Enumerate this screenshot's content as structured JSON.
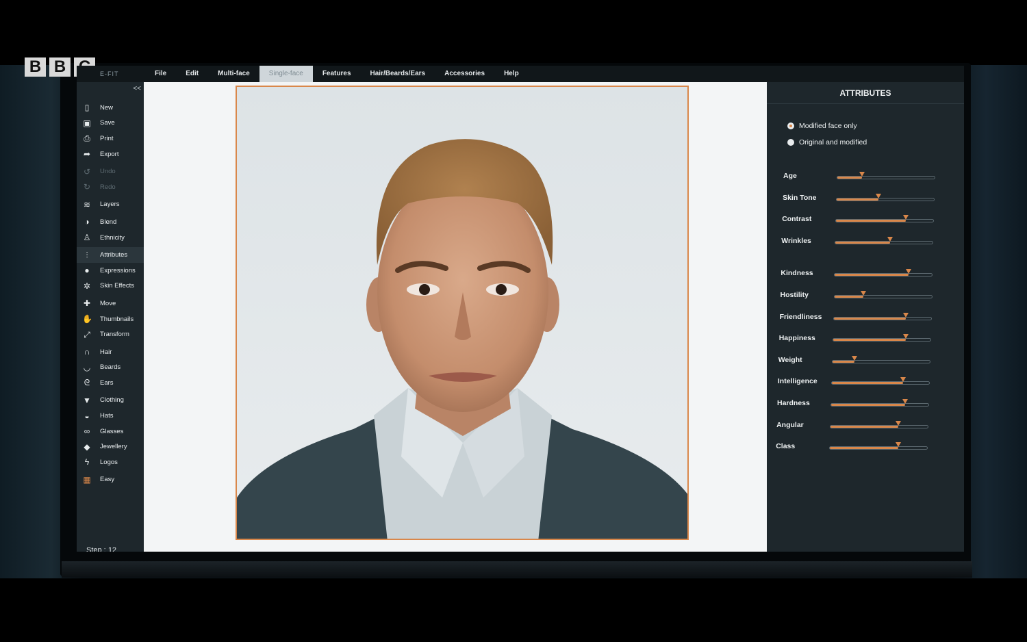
{
  "broadcaster": {
    "letters": [
      "B",
      "B",
      "C"
    ]
  },
  "app": {
    "logo": "E-FIT"
  },
  "menu": [
    {
      "label": "File",
      "active": false
    },
    {
      "label": "Edit",
      "active": false
    },
    {
      "label": "Multi-face",
      "active": false
    },
    {
      "label": "Single-face",
      "active": true
    },
    {
      "label": "Features",
      "active": false
    },
    {
      "label": "Hair/Beards/Ears",
      "active": false
    },
    {
      "label": "Accessories",
      "active": false
    },
    {
      "label": "Help",
      "active": false
    }
  ],
  "toolbar": {
    "collapse": "<<",
    "tools": [
      {
        "label": "New",
        "icon": "file-icon",
        "glyph": "▯",
        "disabled": false
      },
      {
        "label": "Save",
        "icon": "save-icon",
        "glyph": "▣",
        "disabled": false
      },
      {
        "label": "Print",
        "icon": "printer-icon",
        "glyph": "⎙",
        "disabled": false
      },
      {
        "label": "Export",
        "icon": "export-icon",
        "glyph": "➦",
        "disabled": false
      },
      {
        "label": "Undo",
        "icon": "undo-icon",
        "glyph": "↺",
        "disabled": true
      },
      {
        "label": "Redo",
        "icon": "redo-icon",
        "glyph": "↻",
        "disabled": true
      },
      {
        "label": "Layers",
        "icon": "layers-icon",
        "glyph": "≋",
        "disabled": false
      },
      {
        "label": "Blend",
        "icon": "blend-icon",
        "glyph": "◑",
        "disabled": false
      },
      {
        "label": "Ethnicity",
        "icon": "person-icon",
        "glyph": "♙",
        "disabled": false
      },
      {
        "label": "Attributes",
        "icon": "sliders-icon",
        "glyph": "⫶",
        "disabled": false,
        "active": true
      },
      {
        "label": "Expressions",
        "icon": "face-icon",
        "glyph": "●",
        "disabled": false
      },
      {
        "label": "Skin Effects",
        "icon": "sparkle-icon",
        "glyph": "✲",
        "disabled": false
      },
      {
        "label": "Move",
        "icon": "move-icon",
        "glyph": "✚",
        "disabled": false
      },
      {
        "label": "Thumbnails",
        "icon": "hand-icon",
        "glyph": "✋",
        "disabled": false
      },
      {
        "label": "Transform",
        "icon": "transform-icon",
        "glyph": "⤢",
        "disabled": false
      },
      {
        "label": "Hair",
        "icon": "hair-icon",
        "glyph": "∩",
        "disabled": false
      },
      {
        "label": "Beards",
        "icon": "beard-icon",
        "glyph": "◡",
        "disabled": false
      },
      {
        "label": "Ears",
        "icon": "ear-icon",
        "glyph": "ᘓ",
        "disabled": false
      },
      {
        "label": "Clothing",
        "icon": "shirt-icon",
        "glyph": "▼",
        "disabled": false
      },
      {
        "label": "Hats",
        "icon": "hat-icon",
        "glyph": "◒",
        "disabled": false
      },
      {
        "label": "Glasses",
        "icon": "glasses-icon",
        "glyph": "∞",
        "disabled": false
      },
      {
        "label": "Jewellery",
        "icon": "jewel-icon",
        "glyph": "◆",
        "disabled": false
      },
      {
        "label": "Logos",
        "icon": "lightning-icon",
        "glyph": "ϟ",
        "disabled": false
      },
      {
        "label": "Easy",
        "icon": "grid-icon",
        "glyph": "▦",
        "disabled": false,
        "accent": true
      }
    ],
    "step_label": "Step :",
    "step_value": "12"
  },
  "attributes": {
    "title": "ATTRIBUTES",
    "view_options": [
      {
        "label": "Modified face only",
        "selected": true
      },
      {
        "label": "Original and modified",
        "selected": false
      }
    ],
    "sliders": [
      {
        "name": "Age",
        "value": 0.25
      },
      {
        "name": "Skin Tone",
        "value": 0.43
      },
      {
        "name": "Contrast",
        "value": 0.72
      },
      {
        "name": "Wrinkles",
        "value": 0.56
      },
      {
        "name": "Kindness",
        "value": 0.76
      },
      {
        "name": "Hostility",
        "value": 0.3
      },
      {
        "name": "Friendliness",
        "value": 0.74
      },
      {
        "name": "Happiness",
        "value": 0.75
      },
      {
        "name": "Weight",
        "value": 0.23
      },
      {
        "name": "Intelligence",
        "value": 0.73
      },
      {
        "name": "Hardness",
        "value": 0.76
      },
      {
        "name": "Angular",
        "value": 0.7
      },
      {
        "name": "Class",
        "value": 0.7
      }
    ],
    "accent_color": "#d9874a"
  }
}
